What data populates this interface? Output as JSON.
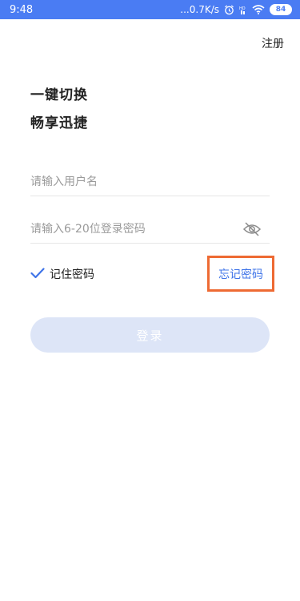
{
  "status_bar": {
    "time": "9:48",
    "network_speed": "...0.7K/s",
    "battery_level": "84",
    "icons": [
      "alarm-icon",
      "hd-icon",
      "wifi-icon",
      "battery-icon"
    ],
    "background": "#4a7cf3"
  },
  "header": {
    "register_label": "注册"
  },
  "slogan": {
    "line1": "一键切换",
    "line2": "畅享迅捷"
  },
  "form": {
    "username": {
      "value": "",
      "placeholder": "请输入用户名"
    },
    "password": {
      "value": "",
      "placeholder": "请输入6-20位登录密码",
      "visibility_icon": "eye-slash-icon"
    },
    "remember": {
      "label": "记住密码",
      "checked": true
    },
    "forgot_label": "忘记密码",
    "login_label": "登录"
  },
  "colors": {
    "accent": "#3f74e8",
    "highlight_box": "#ee6a33",
    "login_button": "#dde5f7"
  }
}
